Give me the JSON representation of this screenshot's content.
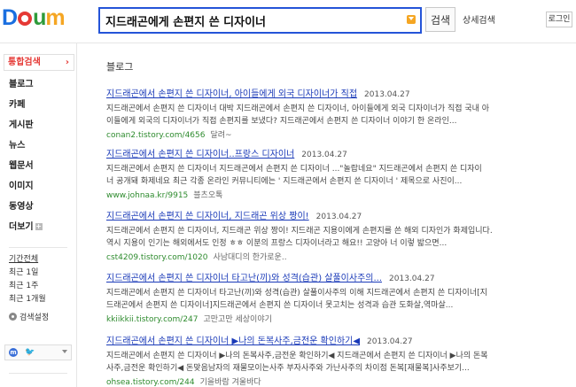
{
  "brand": {
    "logo_text": "Daum"
  },
  "search": {
    "query": "지드래곤에게 손편지 쓴 디자이너",
    "button_label": "검색",
    "advanced_label": "상세검색"
  },
  "header": {
    "login_label": "로그인"
  },
  "sidebar": {
    "main_label": "통합검색",
    "items": [
      {
        "label": "블로그"
      },
      {
        "label": "카페"
      },
      {
        "label": "게시판"
      },
      {
        "label": "뉴스"
      },
      {
        "label": "웹문서"
      },
      {
        "label": "이미지"
      },
      {
        "label": "동영상"
      },
      {
        "label": "더보기"
      }
    ],
    "period_heading": "기간전체",
    "periods": [
      {
        "label": "최근 1일"
      },
      {
        "label": "최근 1주"
      },
      {
        "label": "최근 1개월"
      }
    ],
    "settings_label": "검색설정"
  },
  "section": {
    "title": "블로그"
  },
  "results": [
    {
      "title": "지드래곤에서 손편지 쓴 디자이너, 아이들에게 외국 디자이너가 직접",
      "date": "2013.04.27",
      "desc": [
        "지드래곤에서 손편지 쓴 디자이너 대박 지드래곤에서 손편지 쓴 디자이너, 아이들에게 외국 디자이너가 직접 국내 아",
        "이들에게 외국의 디자이너가 직접 손편지를 보냈다? 지드래곤에서 손편지 쓴 디자이너 이야기 한 온라인..."
      ],
      "url": "conan2.tistory.com/4656",
      "author": "달려~"
    },
    {
      "title": "지드래곤에서 손편지 쓴 디자이너..프랑스 디자이너",
      "date": "2013.04.27",
      "desc": [
        "지드래곤에서 손편지 쓴 디자이너 지드래곤에서 손편지 쓴 디자이너 ...\"놀랍네요\" 지드래곤에서 손편지 쓴 디자이",
        "너 공개돼 화제네요 최근 각종 온라인 커뮤니티에는 ' 지드래곤에서 손편지 쓴 디자이너 ' 제목으로 사진이..."
      ],
      "url": "www.johnaa.kr/9915",
      "author": "블츠오톡"
    },
    {
      "title": "지드래곤에서 손편지 쓴 디자이너, 지드래곤 위상 짱이!",
      "date": "2013.04.27",
      "desc": [
        "지드래곤에서 손편지 쓴 디자이너, 지드래곤 위상 짱이! 지드래곤 지용이에게 손편지를 쓴 해외 디자인가 화제입니다.",
        "역시 지용이 인기는 해외에서도 인정 ㅎㅎ 이분의 프랑스 디자이너라고 해요!! 고양아 너 이렇 밟으면..."
      ],
      "url": "cst4209.tistory.com/1020",
      "author": "사남대디의 한가로운.."
    },
    {
      "title": "지드래곤에서 손편지 쓴 디자이너 타고난(끼)와 성격(습관) 살풀이사주의...",
      "date": "2013.04.27",
      "desc": [
        "지드래곤에서 손편지 쓴 디자이너 타고난(끼)와 성격(습관) 살풀이사주의 이해 지드래곤에서 손편지 쓴 디자이너[지",
        "드래곤에서 손편지 쓴 디자이너]지드래곤에서 손편지 쓴 디자이너 못고치는 성격과 습관 도화살,역마살..."
      ],
      "url": "kkiikkii.tistory.com/247",
      "author": "고만고만 세상이야기"
    },
    {
      "title": "지드래곤에서 손편지 쓴 디자이너 ▶나의 돈복사주,금전운 확인하기◀",
      "date": "2013.04.27",
      "desc": [
        "지드래곤에서 손편지 쓴 디자이너 ▶나의 돈복사주,금전운 확인하기◀ 지드래곤에서 손편지 쓴 디자이너 ▶나의 돈복",
        "사주,금전운 확인하기◀ 돈맞음남자의 재물모이는사주 부자사주와 가난사주의 차이점 돈복[재물복]사주보기..."
      ],
      "url": "ohsea.tistory.com/244",
      "author": "기을바람 겨울바다"
    }
  ]
}
